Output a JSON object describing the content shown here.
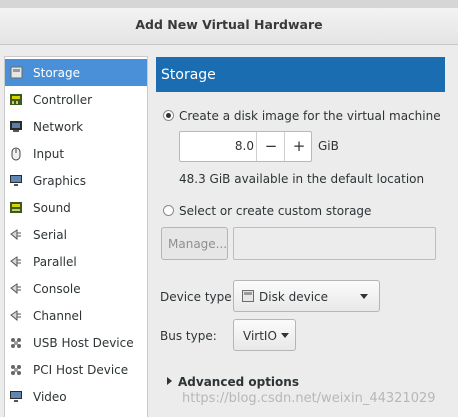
{
  "window": {
    "title": "Add New Virtual Hardware"
  },
  "sidebar": {
    "items": [
      {
        "label": "Storage",
        "icon": "disk-icon",
        "selected": true
      },
      {
        "label": "Controller",
        "icon": "controller-icon"
      },
      {
        "label": "Network",
        "icon": "network-icon"
      },
      {
        "label": "Input",
        "icon": "mouse-icon"
      },
      {
        "label": "Graphics",
        "icon": "monitor-icon"
      },
      {
        "label": "Sound",
        "icon": "sound-card-icon"
      },
      {
        "label": "Serial",
        "icon": "plug-icon"
      },
      {
        "label": "Parallel",
        "icon": "plug-icon"
      },
      {
        "label": "Console",
        "icon": "plug-icon"
      },
      {
        "label": "Channel",
        "icon": "plug-icon"
      },
      {
        "label": "USB Host Device",
        "icon": "usb-device-icon"
      },
      {
        "label": "PCI Host Device",
        "icon": "pci-device-icon"
      },
      {
        "label": "Video",
        "icon": "monitor-icon"
      }
    ]
  },
  "main": {
    "header": "Storage",
    "create_disk": {
      "label": "Create a disk image for the virtual machine",
      "selected": true,
      "size_value": "8.0",
      "decrement_label": "−",
      "increment_label": "+",
      "unit": "GiB",
      "available_text": "48.3 GiB available in the default location"
    },
    "custom_storage": {
      "label": "Select or create custom storage",
      "selected": false,
      "manage_label": "Manage...",
      "path_value": ""
    },
    "device_type": {
      "label": "Device type:",
      "value": "Disk device",
      "icon": "disk-icon"
    },
    "bus_type": {
      "label": "Bus type:",
      "value": "VirtIO"
    },
    "advanced": {
      "label": "Advanced options",
      "expanded": false
    }
  },
  "watermark": "https://blog.csdn.net/weixin_44321029",
  "colors": {
    "selection": "#4a90d9",
    "header": "#1a6db0"
  }
}
